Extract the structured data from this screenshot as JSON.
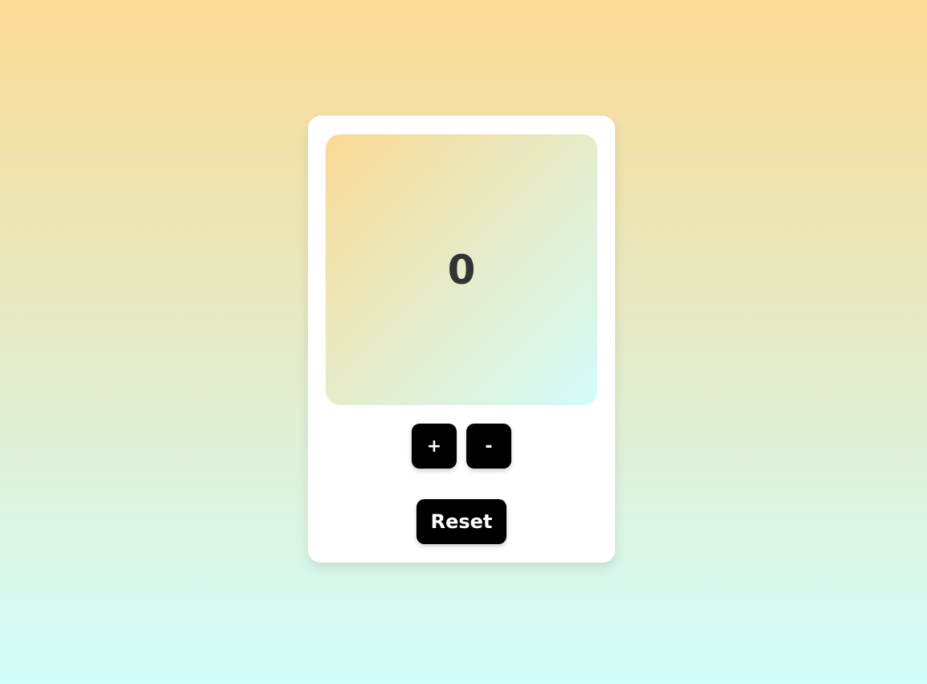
{
  "counter": {
    "value": "0"
  },
  "controls": {
    "increment_label": "+",
    "decrement_label": "-",
    "reset_label": "Reset"
  },
  "colors": {
    "page_gradient_top": "#fadb94",
    "page_gradient_bottom": "#d2fdfb",
    "card_background": "#ffffff",
    "button_background": "#000000",
    "button_text": "#ffffff",
    "count_text": "#333333"
  }
}
